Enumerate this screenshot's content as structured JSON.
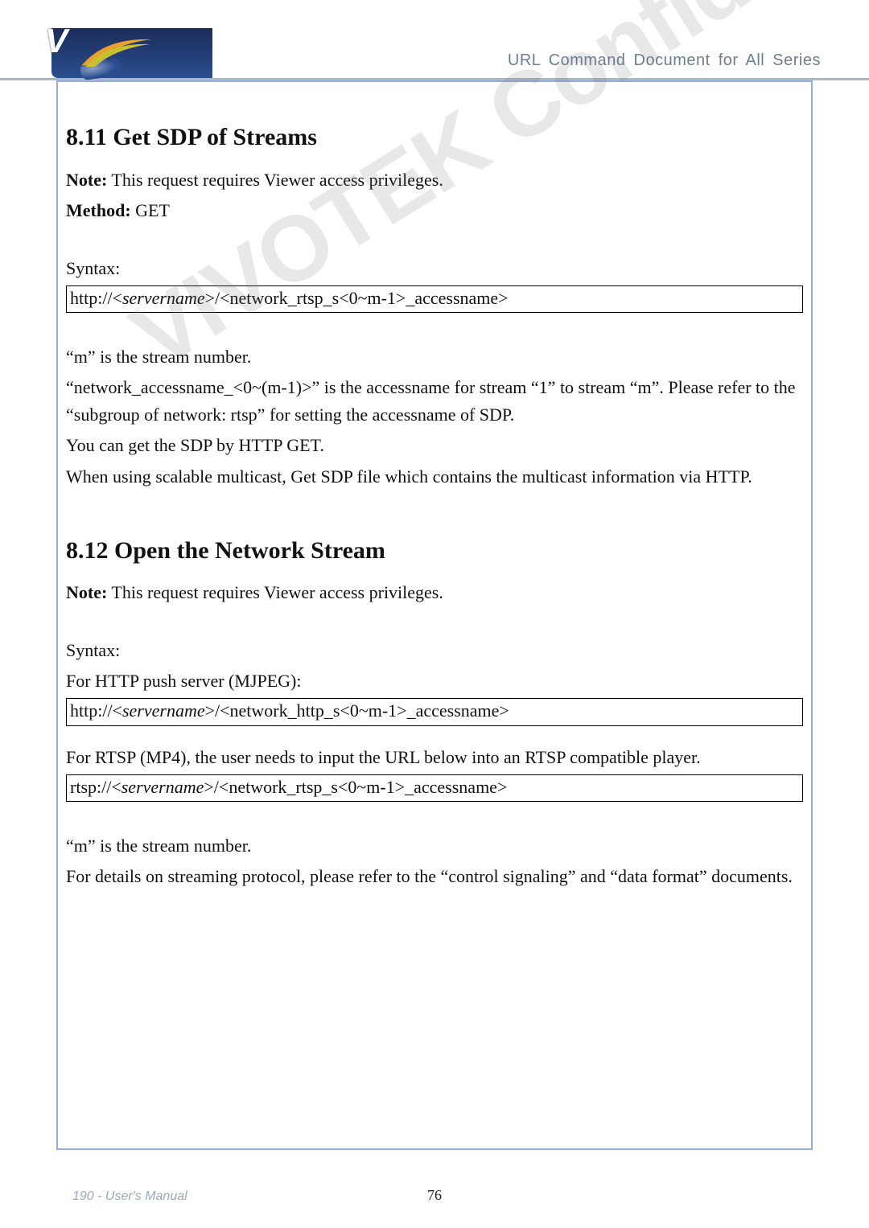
{
  "header": {
    "right_text": "URL Command Document for All Series"
  },
  "watermark": "VIVOTEK Confidential",
  "section_811": {
    "heading": "8.11 Get SDP of Streams",
    "note_label": "Note:",
    "note_text": " This request requires Viewer access privileges.",
    "method_label": "Method:",
    "method_value": " GET",
    "syntax_label": "Syntax:",
    "syntax_line_pre": "http://<",
    "syntax_server": "servername",
    "syntax_line_post": ">/<network_rtsp_s<0~m-1>_accessname>",
    "p1": "“m” is the stream number.",
    "p2": "“network_accessname_<0~(m-1)>” is the accessname for stream “1” to stream “m”. Please refer to the “subgroup of network: rtsp” for setting the accessname of SDP.",
    "p3": "You can get the SDP by HTTP GET.",
    "p4": "When using scalable multicast, Get SDP file which contains the multicast information via HTTP."
  },
  "section_812": {
    "heading": "8.12 Open the Network Stream",
    "note_label": "Note:",
    "note_text": " This request requires Viewer access privileges.",
    "syntax_label": "Syntax:",
    "http_label": "For HTTP push server (MJPEG):",
    "http_line_pre": "http://<",
    "http_server": "servername",
    "http_line_post": ">/<network_http_s<0~m-1>_accessname>",
    "rtsp_label": "For RTSP (MP4), the user needs to input the URL below into an RTSP compatible player.",
    "rtsp_line_pre": "rtsp://<",
    "rtsp_server": "servername",
    "rtsp_line_post": ">/<network_rtsp_s<0~m-1>_accessname>",
    "p1": "“m” is the stream number.",
    "p2": "For details on streaming protocol, please refer to the “control signaling” and “data format” documents."
  },
  "footer": {
    "left": "190 - User's Manual",
    "center": "76"
  }
}
